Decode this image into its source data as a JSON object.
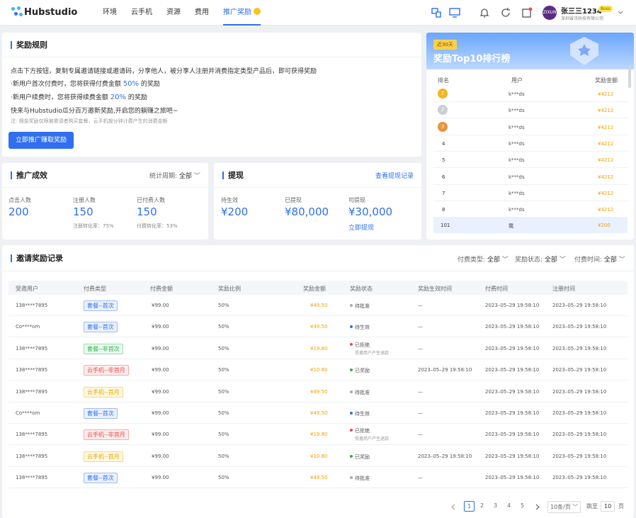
{
  "app": {
    "logo": "Hubstudio"
  },
  "nav": {
    "items": [
      "环境",
      "云手机",
      "资源",
      "费用"
    ],
    "active": "推广奖励"
  },
  "user": {
    "name": "张三三1234",
    "avatar": "ZIXUN",
    "badge": "Boss",
    "company": "深圳省讯科技有限公司"
  },
  "rules": {
    "title": "奖励规则",
    "line1": "点击下方按钮，复制专属邀请链接或邀请码，分享他人，被分享人注册并消费指定类型产品后，即可获得奖励",
    "line2a": "·新用户首次付费时，您将获得付费金额 ",
    "line2b": "50%",
    "line2c": " 的奖励",
    "line3a": "·新用户续费时，您将获得续费金额 ",
    "line3b": "20%",
    "line3c": " 的奖励",
    "line4": "快来与Hubstudio瓜分百万邀新奖励,开启您的躺赚之旅吧~",
    "note": "注: 佣金奖励仅限被邀请者购买套餐、云手机按分钟计费产生的消费金额",
    "button": "立即推广赚取奖励"
  },
  "promo": {
    "title": "推广成效",
    "period_label": "统计周期:",
    "period_value": "全部",
    "stats": [
      {
        "label": "点击人数",
        "value": "200",
        "sub": ""
      },
      {
        "label": "注册人数",
        "value": "150",
        "sub": "注册转化率：75%"
      },
      {
        "label": "已付费人数",
        "value": "150",
        "sub": "付费转化率：53%"
      }
    ]
  },
  "withdraw": {
    "title": "提现",
    "link": "查看提现记录",
    "stats": [
      {
        "label": "待生效",
        "value": "¥200"
      },
      {
        "label": "已提现",
        "value": "¥80,000"
      },
      {
        "label": "可提现",
        "value": "¥30,000"
      }
    ],
    "action": "立即提现"
  },
  "rank": {
    "tag": "近30天",
    "title": "奖励Top10排行榜",
    "cols": [
      "排名",
      "用户",
      "奖励金额"
    ],
    "rows": [
      {
        "rank": "1",
        "user": "k***ds",
        "amount": "¥4212"
      },
      {
        "rank": "2",
        "user": "k***ds",
        "amount": "¥4212"
      },
      {
        "rank": "3",
        "user": "k***ds",
        "amount": "¥4212"
      },
      {
        "rank": "4",
        "user": "k***ds",
        "amount": "¥4212"
      },
      {
        "rank": "5",
        "user": "k***ds",
        "amount": "¥4212"
      },
      {
        "rank": "6",
        "user": "k***ds",
        "amount": "¥4212"
      },
      {
        "rank": "7",
        "user": "k***ds",
        "amount": "¥4212"
      },
      {
        "rank": "8",
        "user": "k***ds",
        "amount": "¥4212"
      }
    ],
    "mine": {
      "rank": "101",
      "user": "我",
      "amount": "¥200"
    }
  },
  "records": {
    "title": "邀请奖励记录",
    "filters": [
      {
        "label": "付费类型:",
        "value": "全部"
      },
      {
        "label": "奖励状态:",
        "value": "全部"
      },
      {
        "label": "付费时间:",
        "value": "全部"
      }
    ],
    "cols": [
      "受邀用户",
      "付费类型",
      "付费金额",
      "奖励比例",
      "奖励金额",
      "奖励状态",
      "奖励生效时间",
      "付费时间",
      "注册时间"
    ],
    "rows": [
      {
        "user": "138****7895",
        "type": "套餐--首次",
        "tc": "blue",
        "amount": "¥99.00",
        "ratio": "50%",
        "reward": "¥49.50",
        "status": "待批准",
        "sc": "#aaaaaa",
        "note": "",
        "eff": "—",
        "pay": "2023–05–29 19:58:10",
        "reg": "2023–05–29 19:58:10"
      },
      {
        "user": "Co****om",
        "type": "套餐--首次",
        "tc": "blue",
        "amount": "¥99.00",
        "ratio": "50%",
        "reward": "¥49.50",
        "status": "待生效",
        "sc": "#2f6ff0",
        "note": "",
        "eff": "—",
        "pay": "2023–05–29 19:58:10",
        "reg": "2023–05–29 19:58:10"
      },
      {
        "user": "138****7895",
        "type": "套餐--非首次",
        "tc": "green",
        "amount": "¥99.00",
        "ratio": "50%",
        "reward": "¥19.80",
        "status": "已拒绝",
        "sc": "#f04a4a",
        "note": "受邀用户产生退款",
        "eff": "—",
        "pay": "2023–05–29 19:58:10",
        "reg": "2023–05–29 19:58:10"
      },
      {
        "user": "138****7895",
        "type": "云手机--非首月",
        "tc": "red",
        "amount": "¥99.00",
        "ratio": "50%",
        "reward": "¥10.80",
        "status": "已奖励",
        "sc": "#2cb24a",
        "note": "",
        "eff": "2023–05–29 19:58:10",
        "pay": "2023–05–29 19:58:10",
        "reg": "2023–05–29 19:58:10"
      },
      {
        "user": "138****7895",
        "type": "云手机--首月",
        "tc": "yellow",
        "amount": "¥99.00",
        "ratio": "50%",
        "reward": "¥49.50",
        "status": "待批准",
        "sc": "#aaaaaa",
        "note": "",
        "eff": "—",
        "pay": "2023–05–29 19:58:10",
        "reg": "2023–05–29 19:58:10"
      },
      {
        "user": "Co****om",
        "type": "套餐--首次",
        "tc": "blue",
        "amount": "¥99.00",
        "ratio": "50%",
        "reward": "¥49.50",
        "status": "待生效",
        "sc": "#2f6ff0",
        "note": "",
        "eff": "—",
        "pay": "2023–05–29 19:58:10",
        "reg": "2023–05–29 19:58:10"
      },
      {
        "user": "138****7895",
        "type": "云手机--非首月",
        "tc": "red",
        "amount": "¥99.00",
        "ratio": "50%",
        "reward": "¥19.80",
        "status": "已拒绝",
        "sc": "#f04a4a",
        "note": "受邀用户产生退款",
        "eff": "—",
        "pay": "2023–05–29 19:58:10",
        "reg": "2023–05–29 19:58:10"
      },
      {
        "user": "138****7895",
        "type": "云手机--首月",
        "tc": "yellow",
        "amount": "¥99.00",
        "ratio": "50%",
        "reward": "¥10.80",
        "status": "已奖励",
        "sc": "#2cb24a",
        "note": "",
        "eff": "2023–05–29 19:58:10",
        "pay": "2023–05–29 19:58:10",
        "reg": "2023–05–29 19:58:10"
      },
      {
        "user": "138****7895",
        "type": "套餐--首次",
        "tc": "blue",
        "amount": "¥99.00",
        "ratio": "50%",
        "reward": "¥49.50",
        "status": "待批准",
        "sc": "#aaaaaa",
        "note": "",
        "eff": "—",
        "pay": "2023–05–29 19:58:10",
        "reg": "2023–05–29 19:58:10"
      }
    ]
  },
  "pagination": {
    "pages": [
      "1",
      "2",
      "3",
      "4",
      "5"
    ],
    "current": "1",
    "page_size": "10条/页",
    "jump_label": "跳至",
    "jump_value": "10",
    "page_suffix": "页"
  }
}
